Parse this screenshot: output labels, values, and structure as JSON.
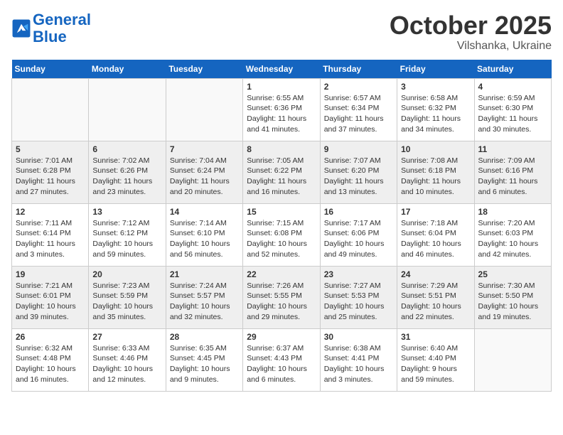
{
  "header": {
    "logo_line1": "General",
    "logo_line2": "Blue",
    "month_title": "October 2025",
    "location": "Vilshanka, Ukraine"
  },
  "weekdays": [
    "Sunday",
    "Monday",
    "Tuesday",
    "Wednesday",
    "Thursday",
    "Friday",
    "Saturday"
  ],
  "weeks": [
    [
      {
        "day": "",
        "info": ""
      },
      {
        "day": "",
        "info": ""
      },
      {
        "day": "",
        "info": ""
      },
      {
        "day": "1",
        "info": "Sunrise: 6:55 AM\nSunset: 6:36 PM\nDaylight: 11 hours\nand 41 minutes."
      },
      {
        "day": "2",
        "info": "Sunrise: 6:57 AM\nSunset: 6:34 PM\nDaylight: 11 hours\nand 37 minutes."
      },
      {
        "day": "3",
        "info": "Sunrise: 6:58 AM\nSunset: 6:32 PM\nDaylight: 11 hours\nand 34 minutes."
      },
      {
        "day": "4",
        "info": "Sunrise: 6:59 AM\nSunset: 6:30 PM\nDaylight: 11 hours\nand 30 minutes."
      }
    ],
    [
      {
        "day": "5",
        "info": "Sunrise: 7:01 AM\nSunset: 6:28 PM\nDaylight: 11 hours\nand 27 minutes."
      },
      {
        "day": "6",
        "info": "Sunrise: 7:02 AM\nSunset: 6:26 PM\nDaylight: 11 hours\nand 23 minutes."
      },
      {
        "day": "7",
        "info": "Sunrise: 7:04 AM\nSunset: 6:24 PM\nDaylight: 11 hours\nand 20 minutes."
      },
      {
        "day": "8",
        "info": "Sunrise: 7:05 AM\nSunset: 6:22 PM\nDaylight: 11 hours\nand 16 minutes."
      },
      {
        "day": "9",
        "info": "Sunrise: 7:07 AM\nSunset: 6:20 PM\nDaylight: 11 hours\nand 13 minutes."
      },
      {
        "day": "10",
        "info": "Sunrise: 7:08 AM\nSunset: 6:18 PM\nDaylight: 11 hours\nand 10 minutes."
      },
      {
        "day": "11",
        "info": "Sunrise: 7:09 AM\nSunset: 6:16 PM\nDaylight: 11 hours\nand 6 minutes."
      }
    ],
    [
      {
        "day": "12",
        "info": "Sunrise: 7:11 AM\nSunset: 6:14 PM\nDaylight: 11 hours\nand 3 minutes."
      },
      {
        "day": "13",
        "info": "Sunrise: 7:12 AM\nSunset: 6:12 PM\nDaylight: 10 hours\nand 59 minutes."
      },
      {
        "day": "14",
        "info": "Sunrise: 7:14 AM\nSunset: 6:10 PM\nDaylight: 10 hours\nand 56 minutes."
      },
      {
        "day": "15",
        "info": "Sunrise: 7:15 AM\nSunset: 6:08 PM\nDaylight: 10 hours\nand 52 minutes."
      },
      {
        "day": "16",
        "info": "Sunrise: 7:17 AM\nSunset: 6:06 PM\nDaylight: 10 hours\nand 49 minutes."
      },
      {
        "day": "17",
        "info": "Sunrise: 7:18 AM\nSunset: 6:04 PM\nDaylight: 10 hours\nand 46 minutes."
      },
      {
        "day": "18",
        "info": "Sunrise: 7:20 AM\nSunset: 6:03 PM\nDaylight: 10 hours\nand 42 minutes."
      }
    ],
    [
      {
        "day": "19",
        "info": "Sunrise: 7:21 AM\nSunset: 6:01 PM\nDaylight: 10 hours\nand 39 minutes."
      },
      {
        "day": "20",
        "info": "Sunrise: 7:23 AM\nSunset: 5:59 PM\nDaylight: 10 hours\nand 35 minutes."
      },
      {
        "day": "21",
        "info": "Sunrise: 7:24 AM\nSunset: 5:57 PM\nDaylight: 10 hours\nand 32 minutes."
      },
      {
        "day": "22",
        "info": "Sunrise: 7:26 AM\nSunset: 5:55 PM\nDaylight: 10 hours\nand 29 minutes."
      },
      {
        "day": "23",
        "info": "Sunrise: 7:27 AM\nSunset: 5:53 PM\nDaylight: 10 hours\nand 25 minutes."
      },
      {
        "day": "24",
        "info": "Sunrise: 7:29 AM\nSunset: 5:51 PM\nDaylight: 10 hours\nand 22 minutes."
      },
      {
        "day": "25",
        "info": "Sunrise: 7:30 AM\nSunset: 5:50 PM\nDaylight: 10 hours\nand 19 minutes."
      }
    ],
    [
      {
        "day": "26",
        "info": "Sunrise: 6:32 AM\nSunset: 4:48 PM\nDaylight: 10 hours\nand 16 minutes."
      },
      {
        "day": "27",
        "info": "Sunrise: 6:33 AM\nSunset: 4:46 PM\nDaylight: 10 hours\nand 12 minutes."
      },
      {
        "day": "28",
        "info": "Sunrise: 6:35 AM\nSunset: 4:45 PM\nDaylight: 10 hours\nand 9 minutes."
      },
      {
        "day": "29",
        "info": "Sunrise: 6:37 AM\nSunset: 4:43 PM\nDaylight: 10 hours\nand 6 minutes."
      },
      {
        "day": "30",
        "info": "Sunrise: 6:38 AM\nSunset: 4:41 PM\nDaylight: 10 hours\nand 3 minutes."
      },
      {
        "day": "31",
        "info": "Sunrise: 6:40 AM\nSunset: 4:40 PM\nDaylight: 9 hours\nand 59 minutes."
      },
      {
        "day": "",
        "info": ""
      }
    ]
  ]
}
